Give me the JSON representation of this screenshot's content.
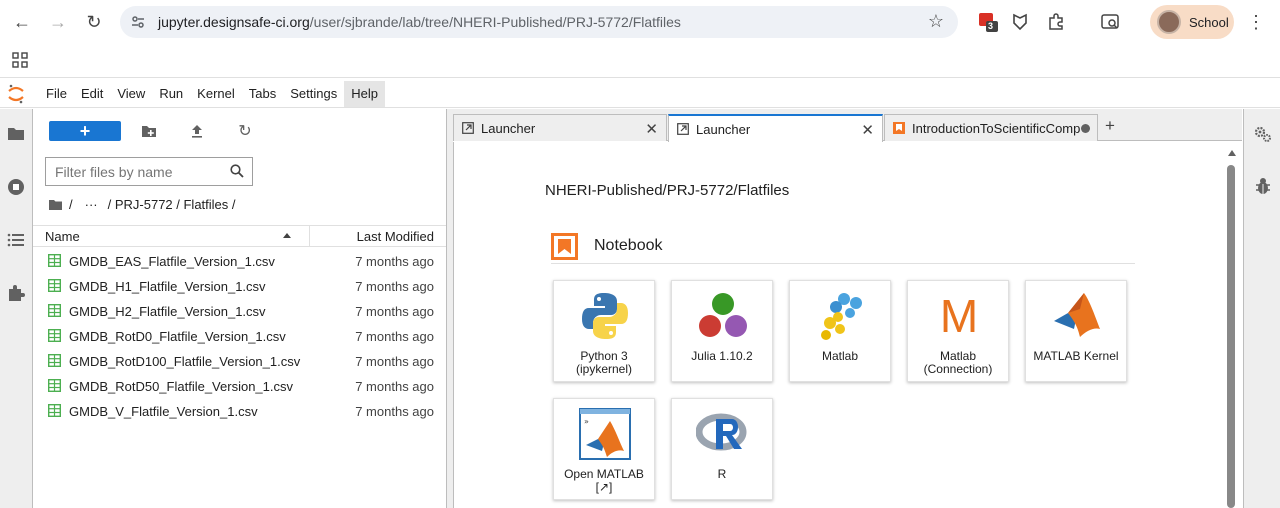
{
  "browser": {
    "url_host": "jupyter.designsafe-ci.org",
    "url_path": "/user/sjbrande/lab/tree/NHERI-Published/PRJ-5772/Flatfiles",
    "extension_badge": "3",
    "profile_name": "School"
  },
  "menu": [
    "File",
    "Edit",
    "View",
    "Run",
    "Kernel",
    "Tabs",
    "Settings",
    "Help"
  ],
  "filebrowser": {
    "new_label": "+",
    "filter_placeholder": "Filter files by name",
    "crumbs": {
      "root": "/",
      "ellipsis": "···",
      "path": "/ PRJ-5772 / Flatfiles /"
    },
    "col_name": "Name",
    "col_modified": "Last Modified",
    "files": [
      {
        "name": "GMDB_EAS_Flatfile_Version_1.csv",
        "modified": "7 months ago"
      },
      {
        "name": "GMDB_H1_Flatfile_Version_1.csv",
        "modified": "7 months ago"
      },
      {
        "name": "GMDB_H2_Flatfile_Version_1.csv",
        "modified": "7 months ago"
      },
      {
        "name": "GMDB_RotD0_Flatfile_Version_1.csv",
        "modified": "7 months ago"
      },
      {
        "name": "GMDB_RotD100_Flatfile_Version_1.csv",
        "modified": "7 months ago"
      },
      {
        "name": "GMDB_RotD50_Flatfile_Version_1.csv",
        "modified": "7 months ago"
      },
      {
        "name": "GMDB_V_Flatfile_Version_1.csv",
        "modified": "7 months ago"
      }
    ]
  },
  "tabs": [
    {
      "label": "Launcher"
    },
    {
      "label": "Launcher"
    },
    {
      "label": "IntroductionToScientificComp"
    }
  ],
  "launcher": {
    "path": "NHERI-Published/PRJ-5772/Flatfiles",
    "section": "Notebook",
    "cards": [
      {
        "line1": "Python 3",
        "line2": "(ipykernel)"
      },
      {
        "line1": "Julia 1.10.2",
        "line2": ""
      },
      {
        "line1": "Matlab",
        "line2": ""
      },
      {
        "line1": "Matlab",
        "line2": "(Connection)"
      },
      {
        "line1": "MATLAB Kernel",
        "line2": ""
      },
      {
        "line1": "Open MATLAB",
        "line2": "[↗]"
      },
      {
        "line1": "R",
        "line2": ""
      }
    ]
  },
  "colors": {
    "accent": "#1976d2",
    "csv_icon": "#4caf50",
    "matlab_orange": "#e8731e",
    "jupyter_orange": "#f37726"
  }
}
